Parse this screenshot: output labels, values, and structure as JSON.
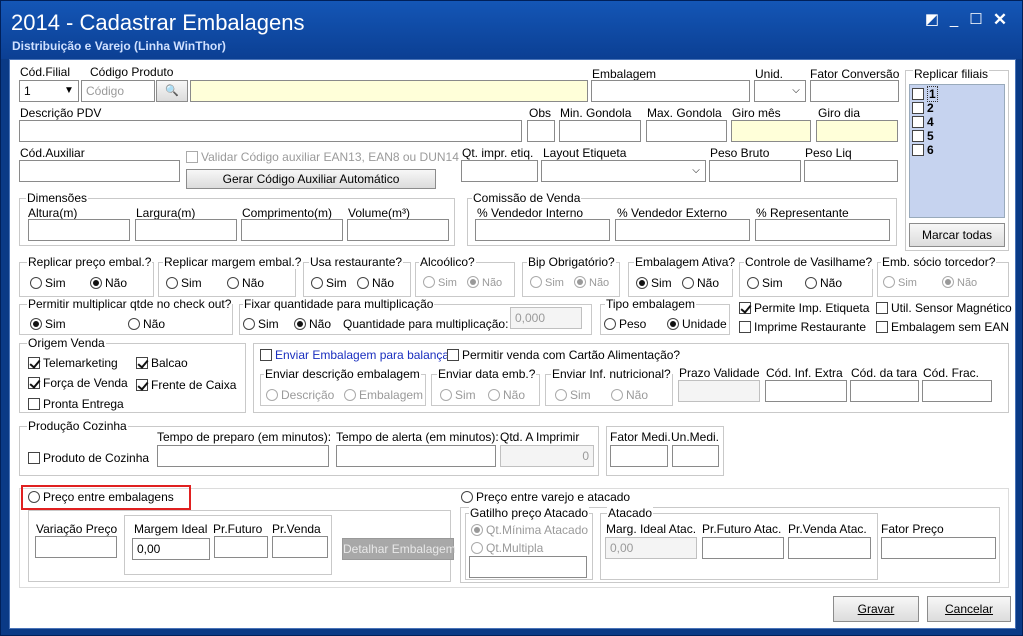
{
  "window": {
    "title": "2014 - Cadastrar Embalagens",
    "subtitle": "Distribuição e Varejo (Linha WinThor)",
    "icons": [
      "restore-icon",
      "minimize-icon",
      "maximize-icon",
      "close-icon"
    ]
  },
  "top": {
    "cod_filial": "Cód.Filial",
    "cod_filial_value": "1",
    "cod_produto": "Código Produto",
    "codigo_placeholder": "Código",
    "embalagem": "Embalagem",
    "unid": "Unid.",
    "fator_conversao": "Fator Conversão"
  },
  "replicar": {
    "title": "Replicar filiais",
    "items": [
      "1",
      "2",
      "4",
      "5",
      "6"
    ],
    "marcar": "Marcar todas"
  },
  "row2": {
    "descricao_pdv": "Descrição PDV",
    "obs": "Obs",
    "min_gondola": "Min. Gondola",
    "max_gondola": "Max. Gondola",
    "giro_mes": "Giro mês",
    "giro_dia": "Giro dia"
  },
  "row3": {
    "cod_auxiliar": "Cód.Auxiliar",
    "validar": "Validar Código auxiliar EAN13, EAN8 ou DUN14",
    "gerar": "Gerar Código Auxiliar Automático",
    "qt_impr": "Qt. impr. etiq.",
    "layout": "Layout Etiqueta",
    "peso_bruto": "Peso Bruto",
    "peso_liq": "Peso Liq"
  },
  "dimensoes": {
    "title": "Dimensões",
    "altura": "Altura(m)",
    "largura": "Largura(m)",
    "comprimento": "Comprimento(m)",
    "volume": "Volume(m³)"
  },
  "comissao": {
    "title": "Comissão de Venda",
    "interno": "% Vendedor Interno",
    "externo": "% Vendedor Externo",
    "representante": "% Representante"
  },
  "opts": {
    "sim": "Sim",
    "nao": "Não",
    "replicar_preco": "Replicar preço embal.?",
    "replicar_margem": "Replicar margem embal.?",
    "usa_restaurante": "Usa restaurante?",
    "alcoolico": "Alcoólico?",
    "bip": "Bip Obrigatório?",
    "ativa": "Embalagem Ativa?",
    "vasilhame": "Controle de Vasilhame?",
    "socio": "Emb. sócio torcedor?"
  },
  "mult": {
    "permitir": "Permitir multiplicar qtde no check out?",
    "fixar": "Fixar quantidade para multiplicação",
    "qtd_label": "Quantidade para multiplicação:",
    "qtd_value": "0,000",
    "tipo": "Tipo embalagem",
    "peso": "Peso",
    "unidade": "Unidade",
    "permite_imp": "Permite Imp. Etiqueta",
    "sensor": "Util. Sensor Magnético",
    "imprime_rest": "Imprime Restaurante",
    "sem_ean": "Embalagem sem EAN"
  },
  "origem": {
    "title": "Origem Venda",
    "telemarketing": "Telemarketing",
    "balcao": "Balcao",
    "forca": "Força de Venda",
    "frente": "Frente de Caixa",
    "pronta": "Pronta Entrega"
  },
  "balanca": {
    "enviar": "Enviar Embalagem para balança",
    "cartao": "Permitir venda com Cartão Alimentação?",
    "desc": "Enviar descrição embalagem",
    "descricao": "Descrição",
    "embalagem": "Embalagem",
    "data": "Enviar data emb.?",
    "nutri": "Enviar Inf. nutricional?",
    "prazo": "Prazo Validade",
    "inf_extra": "Cód. Inf. Extra",
    "tara": "Cód. da tara",
    "frac": "Cód. Frac."
  },
  "producao": {
    "title": "Produção Cozinha",
    "produto": "Produto de Cozinha",
    "preparo": "Tempo de preparo (em minutos):",
    "alerta": "Tempo de alerta (em minutos):",
    "qtd": "Qtd. A Imprimir",
    "qtd_value": "0",
    "fator": "Fator Medi.",
    "un": "Un.Medi."
  },
  "preco": {
    "entre_emb": "Preço entre embalagens",
    "variacao": "Variação Preço",
    "margem": "Margem Ideal",
    "margem_value": "0,00",
    "futuro": "Pr.Futuro",
    "venda": "Pr.Venda",
    "detalhar": "Detalhar Embalagem",
    "entre_varejo": "Preço entre varejo e atacado",
    "gatilho": "Gatilho preço Atacado",
    "qt_min": "Qt.Mínima Atacado",
    "qt_mult": "Qt.Multipla",
    "atacado": "Atacado",
    "marg_atac": "Marg. Ideal Atac.",
    "futuro_atac": "Pr.Futuro Atac.",
    "venda_atac": "Pr.Venda Atac.",
    "marg_atac_value": "0,00",
    "fator_preco": "Fator Preço"
  },
  "buttons": {
    "gravar": "Gravar",
    "cancelar": "Cancelar"
  }
}
